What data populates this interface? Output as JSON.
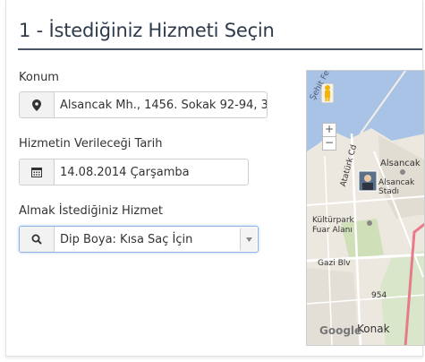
{
  "page": {
    "title": "1 - İstediğiniz Hizmeti Seçin"
  },
  "form": {
    "location": {
      "label": "Konum",
      "value": "Alsancak Mh., 1456. Sokak 92-94, 3…",
      "icon": "map-marker-icon"
    },
    "date": {
      "label": "Hizmetin Verileceği Tarih",
      "value": "14.08.2014 Çarşamba",
      "icon": "calendar-icon"
    },
    "service": {
      "label": "Almak İstediğiniz Hizmet",
      "value": "Dip Boya: Kısa Saç İçin",
      "icon": "search-icon"
    }
  },
  "map": {
    "zoom_in": "+",
    "zoom_out": "−",
    "labels": {
      "street_top": "Şehit Fethi Bey Cd.",
      "alsancak": "Alsancak",
      "stadium": "Alsancak Stadı",
      "ataturk_cd": "Atatürk Cd",
      "kulturpark": "Kültürpark Fuar Alanı",
      "gazi": "Gazi Blv",
      "street_954": "954",
      "konak": "Konak",
      "google": "Google"
    }
  }
}
